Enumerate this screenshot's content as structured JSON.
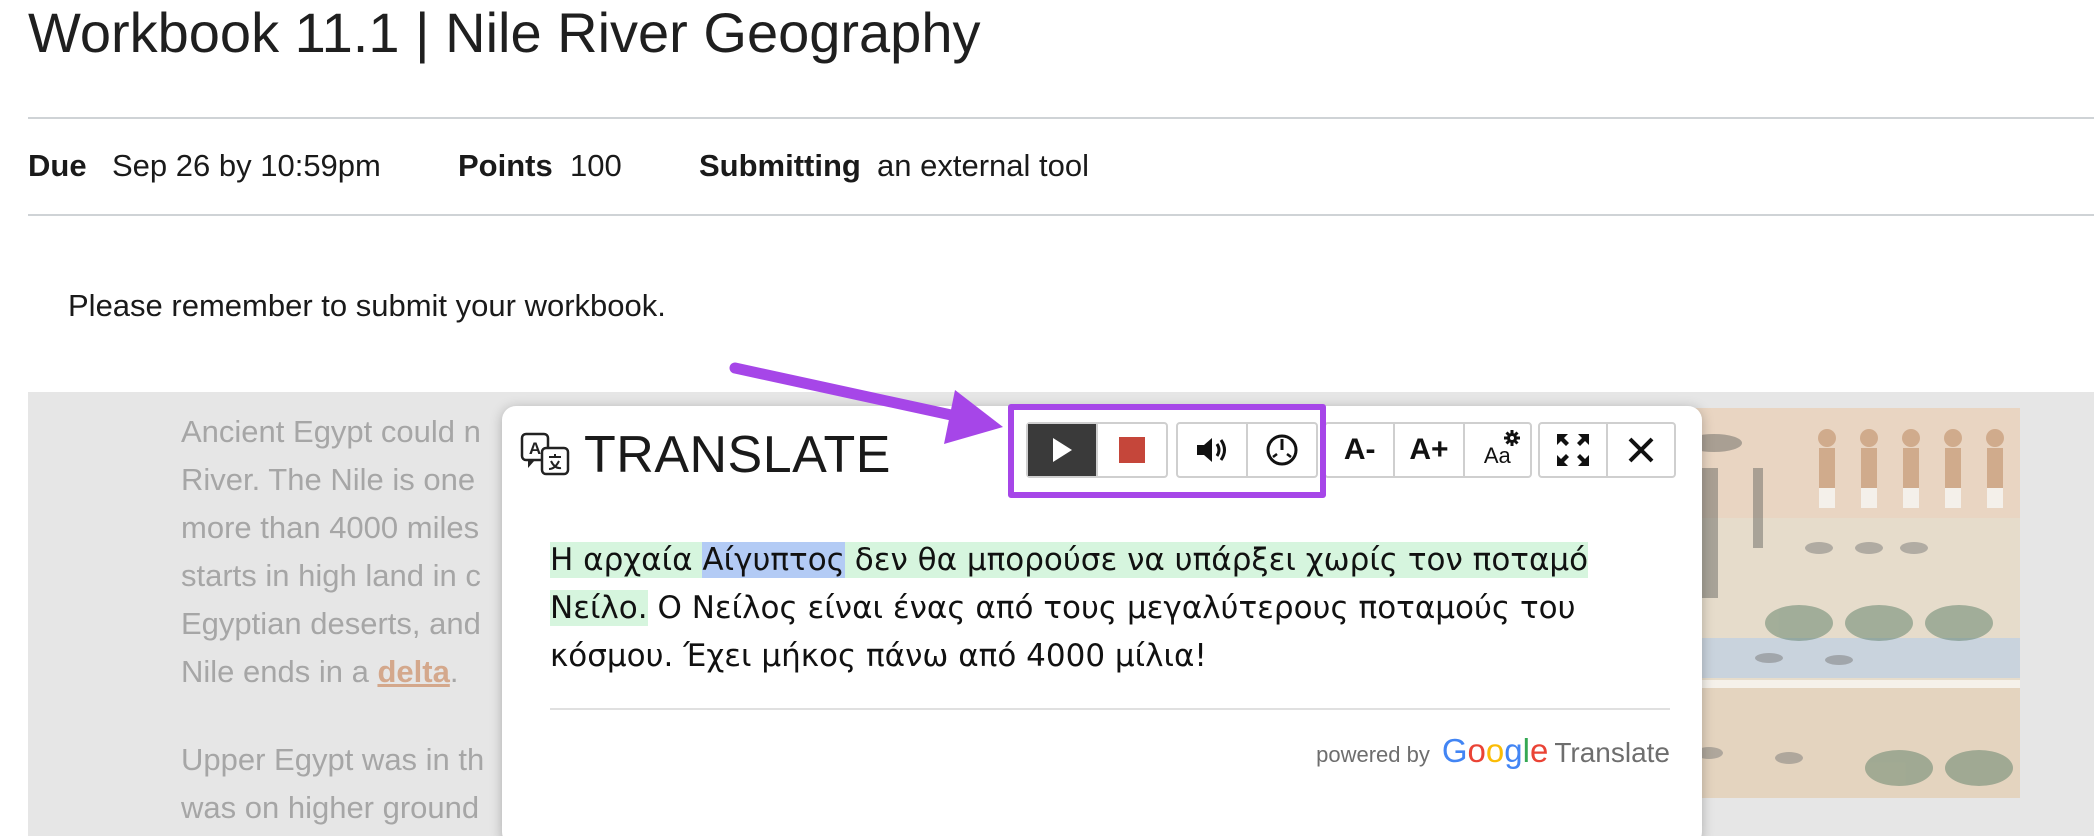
{
  "page": {
    "title": "Workbook 11.1 | Nile River Geography"
  },
  "details": {
    "due_label": "Due",
    "due_value": "Sep 26 by 10:59pm",
    "points_label": "Points",
    "points_value": "100",
    "submitting_label": "Submitting",
    "submitting_value": "an external tool"
  },
  "notice": "Please remember to submit your workbook.",
  "content": {
    "para1_lines": [
      "Ancient Egypt could n",
      "River. The Nile is one",
      "more than 4000 miles",
      "starts in high land in c",
      "Egyptian deserts, and"
    ],
    "para1_last_prefix": "Nile ends in a ",
    "para1_link": "delta",
    "para1_last_suffix": ".",
    "para2_lines": [
      "Upper Egypt was in th",
      "was on higher ground"
    ]
  },
  "translate_panel": {
    "title": "TRANSLATE",
    "icons": [
      "translate-icon",
      "play-icon",
      "stop-icon",
      "volume-icon",
      "speed-icon",
      "decrease-font-icon",
      "increase-font-icon",
      "font-settings-icon",
      "fullscreen-icon",
      "close-icon"
    ],
    "font_decrease_label": "A-",
    "font_increase_label": "A+",
    "font_settings_label": "Aa",
    "translation_hl_pre": "Η αρχαία ",
    "translation_hl_word": "Αίγυπτος",
    "translation_hl_post": " δεν θα μπορούσε να υπάρξει χωρίς τον ποταμό Νείλο.",
    "translation_rest": " Ο Νείλος είναι ένας από τους μεγαλύτερους ποταμούς του κόσμου. Έχει μήκος πάνω από 4000 μίλια!",
    "powered_by": "powered by",
    "google_letters": [
      "G",
      "o",
      "o",
      "g",
      "l",
      "e"
    ],
    "google_translate_label": "Translate",
    "colors": {
      "highlight_sentence": "#d6f5de",
      "highlight_word": "#b3cbf5",
      "annotation": "#a646e8",
      "stop": "#c5463a"
    }
  }
}
